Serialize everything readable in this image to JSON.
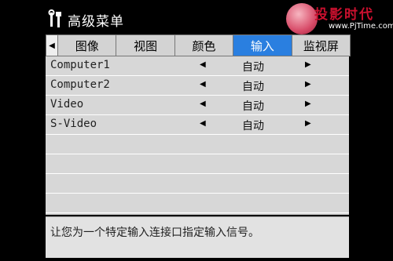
{
  "header": {
    "title": "高级菜单",
    "icon": "tools-icon"
  },
  "watermark": {
    "title": "投影时代",
    "url": "www.PjTime.com"
  },
  "tabs": {
    "left_arrow": "◀",
    "items": [
      {
        "label": "图像",
        "active": false
      },
      {
        "label": "视图",
        "active": false
      },
      {
        "label": "颜色",
        "active": false
      },
      {
        "label": "输入",
        "active": true
      },
      {
        "label": "监视屏",
        "active": false
      }
    ]
  },
  "rows": [
    {
      "label": "Computer1",
      "value": "自动"
    },
    {
      "label": "Computer2",
      "value": "自动"
    },
    {
      "label": "Video",
      "value": "自动"
    },
    {
      "label": "S-Video",
      "value": "自动"
    }
  ],
  "arrows": {
    "left": "◀",
    "right": "▶"
  },
  "help_text": "让您为一个特定输入连接口指定输入信号。",
  "colors": {
    "accent": "#2a7fe0",
    "panel": "#d7d7d7",
    "background": "#000000"
  }
}
